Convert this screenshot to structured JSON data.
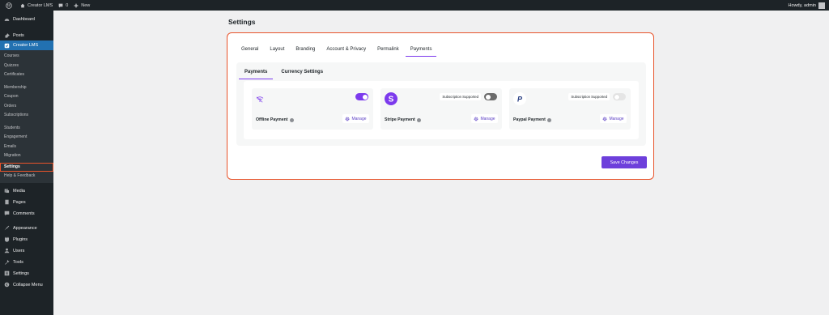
{
  "adminbar": {
    "site_name": "Creator LMS",
    "comments_count": "0",
    "new_label": "New",
    "howdy": "Howdy, admin"
  },
  "sidebar": {
    "dashboard": "Dashboard",
    "posts": "Posts",
    "creator_lms": "Creator LMS",
    "sub": [
      "Courses",
      "Quizzes",
      "Certificates",
      "Membership",
      "Coupon",
      "Orders",
      "Subscriptions",
      "Students",
      "Engagement",
      "Emails",
      "Migration",
      "Settings",
      "Help & Feedback"
    ],
    "media": "Media",
    "pages": "Pages",
    "comments": "Comments",
    "appearance": "Appearance",
    "plugins": "Plugins",
    "users": "Users",
    "tools": "Tools",
    "settings": "Settings",
    "collapse": "Collapse Menu"
  },
  "page": {
    "title": "Settings",
    "tabs": [
      "General",
      "Layout",
      "Branding",
      "Account & Privacy",
      "Permalink",
      "Payments"
    ],
    "active_tab": "Payments",
    "subtabs": [
      "Payments",
      "Currency Settings"
    ],
    "save_label": "Save Changes"
  },
  "gateways": [
    {
      "name": "Offline Payment",
      "enabled": true,
      "badge": "",
      "manage": "Manage",
      "icon": "wifi-icon"
    },
    {
      "name": "Stripe Payment",
      "enabled": false,
      "badge": "Subscription Supported",
      "manage": "Manage",
      "icon": "stripe-logo-icon"
    },
    {
      "name": "Paypal Payment",
      "enabled": false,
      "badge": "Subscription Supported",
      "manage": "Manage",
      "icon": "paypal-logo-icon"
    }
  ],
  "colors": {
    "accent": "#7c3aed",
    "highlight": "#e8532a",
    "wp_blue": "#2271b1"
  }
}
